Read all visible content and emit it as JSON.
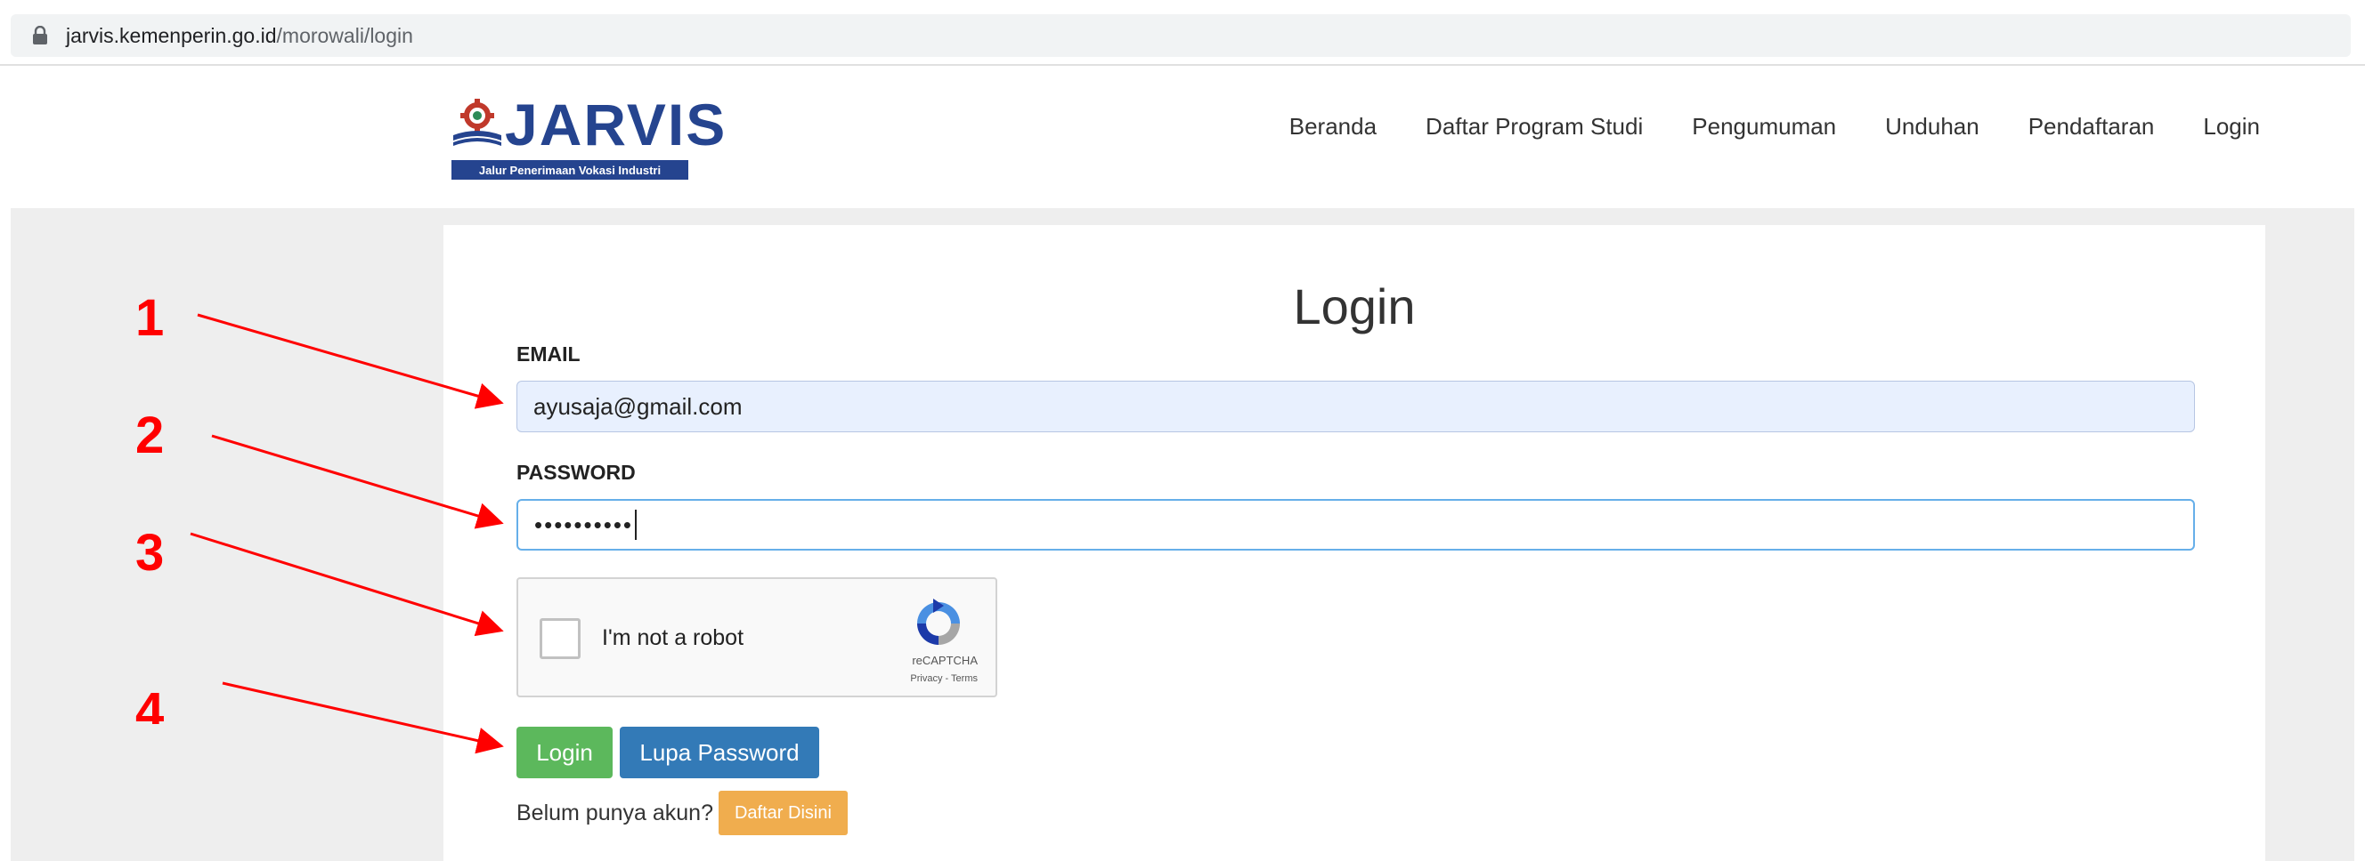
{
  "browser": {
    "url_host": "jarvis.kemenperin.go.id",
    "url_path": "/morowali/login"
  },
  "logo": {
    "word": "JARVIS",
    "tagline": "Jalur Penerimaan Vokasi Industri"
  },
  "nav": {
    "items": [
      "Beranda",
      "Daftar Program Studi",
      "Pengumuman",
      "Unduhan",
      "Pendaftaran",
      "Login"
    ]
  },
  "form": {
    "title": "Login",
    "email_label": "EMAIL",
    "email_value": "ayusaja@gmail.com",
    "password_label": "PASSWORD",
    "password_value": "••••••••••",
    "captcha_text": "I'm not a robot",
    "captcha_brand": "reCAPTCHA",
    "captcha_links": "Privacy - Terms",
    "login_button": "Login",
    "forgot_button": "Lupa Password",
    "register_prompt": "Belum punya akun?",
    "register_button": "Daftar Disini"
  },
  "annotations": {
    "step1": "1",
    "step2": "2",
    "step3": "3",
    "step4": "4"
  },
  "colors": {
    "brand": "#25448f",
    "annotation": "#ff0000",
    "login_button": "#5cb85c",
    "forgot_button": "#337ab7",
    "register_button": "#f0ad4e"
  }
}
